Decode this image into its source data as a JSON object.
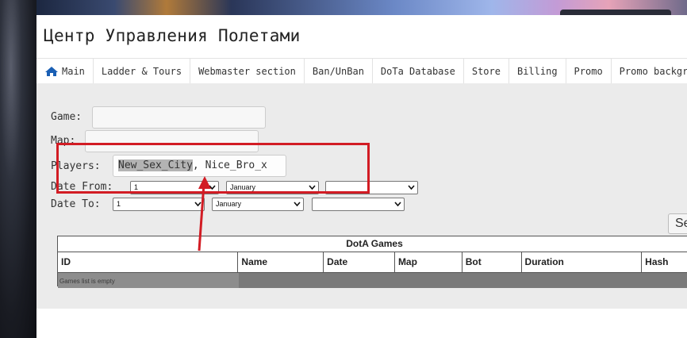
{
  "site_title": "Центр Управления Полетами",
  "nav": {
    "items": [
      {
        "label": "Main",
        "icon": "home-icon"
      },
      {
        "label": "Ladder & Tours"
      },
      {
        "label": "Webmaster section"
      },
      {
        "label": "Ban/UnBan"
      },
      {
        "label": "DoTa Database"
      },
      {
        "label": "Store"
      },
      {
        "label": "Billing"
      },
      {
        "label": "Promo"
      },
      {
        "label": "Promo backgro"
      }
    ]
  },
  "form": {
    "game_label": "Game:",
    "game_value": "",
    "map_label": "Map:",
    "map_value": "",
    "players_label": "Players:",
    "players_highlighted": "New_Sex_City",
    "players_rest": ", Nice_Bro_x",
    "date_from_label": "Date From:",
    "date_from": {
      "day": "1",
      "month": "January",
      "year": ""
    },
    "date_to_label": "Date To:",
    "date_to": {
      "day": "1",
      "month": "January",
      "year": ""
    },
    "search_button": "Se"
  },
  "games_table": {
    "title": "DotA Games",
    "columns": [
      "ID",
      "Name",
      "Date",
      "Map",
      "Bot",
      "Duration",
      "Hash"
    ],
    "empty_message": "Games list is empty"
  },
  "colors": {
    "accent_blue": "#1a5fb4",
    "annotation_red": "#d21c24"
  }
}
